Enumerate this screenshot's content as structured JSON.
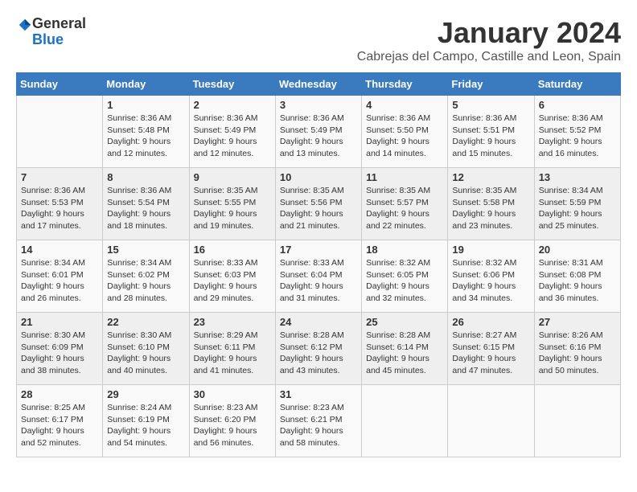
{
  "logo": {
    "general": "General",
    "blue": "Blue"
  },
  "title": "January 2024",
  "location": "Cabrejas del Campo, Castille and Leon, Spain",
  "days_header": [
    "Sunday",
    "Monday",
    "Tuesday",
    "Wednesday",
    "Thursday",
    "Friday",
    "Saturday"
  ],
  "weeks": [
    [
      {
        "day": "",
        "info": ""
      },
      {
        "day": "1",
        "info": "Sunrise: 8:36 AM\nSunset: 5:48 PM\nDaylight: 9 hours\nand 12 minutes."
      },
      {
        "day": "2",
        "info": "Sunrise: 8:36 AM\nSunset: 5:49 PM\nDaylight: 9 hours\nand 12 minutes."
      },
      {
        "day": "3",
        "info": "Sunrise: 8:36 AM\nSunset: 5:49 PM\nDaylight: 9 hours\nand 13 minutes."
      },
      {
        "day": "4",
        "info": "Sunrise: 8:36 AM\nSunset: 5:50 PM\nDaylight: 9 hours\nand 14 minutes."
      },
      {
        "day": "5",
        "info": "Sunrise: 8:36 AM\nSunset: 5:51 PM\nDaylight: 9 hours\nand 15 minutes."
      },
      {
        "day": "6",
        "info": "Sunrise: 8:36 AM\nSunset: 5:52 PM\nDaylight: 9 hours\nand 16 minutes."
      }
    ],
    [
      {
        "day": "7",
        "info": "Sunrise: 8:36 AM\nSunset: 5:53 PM\nDaylight: 9 hours\nand 17 minutes."
      },
      {
        "day": "8",
        "info": "Sunrise: 8:36 AM\nSunset: 5:54 PM\nDaylight: 9 hours\nand 18 minutes."
      },
      {
        "day": "9",
        "info": "Sunrise: 8:35 AM\nSunset: 5:55 PM\nDaylight: 9 hours\nand 19 minutes."
      },
      {
        "day": "10",
        "info": "Sunrise: 8:35 AM\nSunset: 5:56 PM\nDaylight: 9 hours\nand 21 minutes."
      },
      {
        "day": "11",
        "info": "Sunrise: 8:35 AM\nSunset: 5:57 PM\nDaylight: 9 hours\nand 22 minutes."
      },
      {
        "day": "12",
        "info": "Sunrise: 8:35 AM\nSunset: 5:58 PM\nDaylight: 9 hours\nand 23 minutes."
      },
      {
        "day": "13",
        "info": "Sunrise: 8:34 AM\nSunset: 5:59 PM\nDaylight: 9 hours\nand 25 minutes."
      }
    ],
    [
      {
        "day": "14",
        "info": "Sunrise: 8:34 AM\nSunset: 6:01 PM\nDaylight: 9 hours\nand 26 minutes."
      },
      {
        "day": "15",
        "info": "Sunrise: 8:34 AM\nSunset: 6:02 PM\nDaylight: 9 hours\nand 28 minutes."
      },
      {
        "day": "16",
        "info": "Sunrise: 8:33 AM\nSunset: 6:03 PM\nDaylight: 9 hours\nand 29 minutes."
      },
      {
        "day": "17",
        "info": "Sunrise: 8:33 AM\nSunset: 6:04 PM\nDaylight: 9 hours\nand 31 minutes."
      },
      {
        "day": "18",
        "info": "Sunrise: 8:32 AM\nSunset: 6:05 PM\nDaylight: 9 hours\nand 32 minutes."
      },
      {
        "day": "19",
        "info": "Sunrise: 8:32 AM\nSunset: 6:06 PM\nDaylight: 9 hours\nand 34 minutes."
      },
      {
        "day": "20",
        "info": "Sunrise: 8:31 AM\nSunset: 6:08 PM\nDaylight: 9 hours\nand 36 minutes."
      }
    ],
    [
      {
        "day": "21",
        "info": "Sunrise: 8:30 AM\nSunset: 6:09 PM\nDaylight: 9 hours\nand 38 minutes."
      },
      {
        "day": "22",
        "info": "Sunrise: 8:30 AM\nSunset: 6:10 PM\nDaylight: 9 hours\nand 40 minutes."
      },
      {
        "day": "23",
        "info": "Sunrise: 8:29 AM\nSunset: 6:11 PM\nDaylight: 9 hours\nand 41 minutes."
      },
      {
        "day": "24",
        "info": "Sunrise: 8:28 AM\nSunset: 6:12 PM\nDaylight: 9 hours\nand 43 minutes."
      },
      {
        "day": "25",
        "info": "Sunrise: 8:28 AM\nSunset: 6:14 PM\nDaylight: 9 hours\nand 45 minutes."
      },
      {
        "day": "26",
        "info": "Sunrise: 8:27 AM\nSunset: 6:15 PM\nDaylight: 9 hours\nand 47 minutes."
      },
      {
        "day": "27",
        "info": "Sunrise: 8:26 AM\nSunset: 6:16 PM\nDaylight: 9 hours\nand 50 minutes."
      }
    ],
    [
      {
        "day": "28",
        "info": "Sunrise: 8:25 AM\nSunset: 6:17 PM\nDaylight: 9 hours\nand 52 minutes."
      },
      {
        "day": "29",
        "info": "Sunrise: 8:24 AM\nSunset: 6:19 PM\nDaylight: 9 hours\nand 54 minutes."
      },
      {
        "day": "30",
        "info": "Sunrise: 8:23 AM\nSunset: 6:20 PM\nDaylight: 9 hours\nand 56 minutes."
      },
      {
        "day": "31",
        "info": "Sunrise: 8:23 AM\nSunset: 6:21 PM\nDaylight: 9 hours\nand 58 minutes."
      },
      {
        "day": "",
        "info": ""
      },
      {
        "day": "",
        "info": ""
      },
      {
        "day": "",
        "info": ""
      }
    ]
  ]
}
